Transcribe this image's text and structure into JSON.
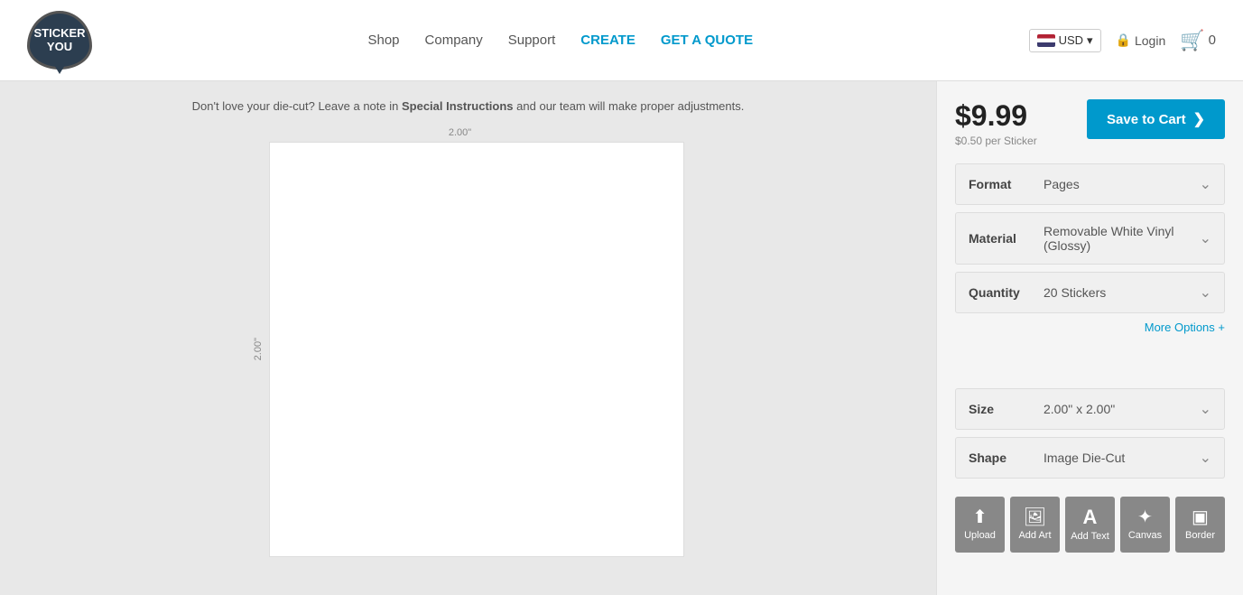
{
  "header": {
    "logo_line1": "STICKER",
    "logo_line2": "YOU",
    "nav": {
      "shop": "Shop",
      "company": "Company",
      "support": "Support",
      "create": "CREATE",
      "get_a_quote": "GET A QUOTE"
    },
    "currency": "USD",
    "login": "Login",
    "cart_count": "0"
  },
  "canvas": {
    "instruction_prefix": "Don't love your die-cut?",
    "instruction_middle": " Leave a note in ",
    "instruction_special": "Special Instructions",
    "instruction_suffix": " and our team will make proper adjustments.",
    "dimension_top": "2.00\"",
    "dimension_left": "2.00\""
  },
  "product": {
    "price": "$9.99",
    "price_per": "$0.50 per Sticker",
    "save_to_cart": "Save to Cart",
    "format_label": "Format",
    "format_value": "Pages",
    "material_label": "Material",
    "material_value": "Removable White Vinyl (Glossy)",
    "quantity_label": "Quantity",
    "quantity_value": "20 Stickers",
    "more_options": "More Options +",
    "size_label": "Size",
    "size_value": "2.00\" x 2.00\"",
    "shape_label": "Shape",
    "shape_value": "Image Die-Cut"
  },
  "toolbar": {
    "upload": "Upload",
    "add_art": "Add Art",
    "add_text": "Add Text",
    "canvas": "Canvas",
    "border": "Border"
  },
  "icons": {
    "upload": "⬆",
    "add_art": "🖼",
    "add_text": "A",
    "canvas": "✦",
    "border": "▣",
    "chevron_down": "⌄",
    "chevron_right": "❯",
    "lock": "🔒",
    "cart": "🛒"
  }
}
